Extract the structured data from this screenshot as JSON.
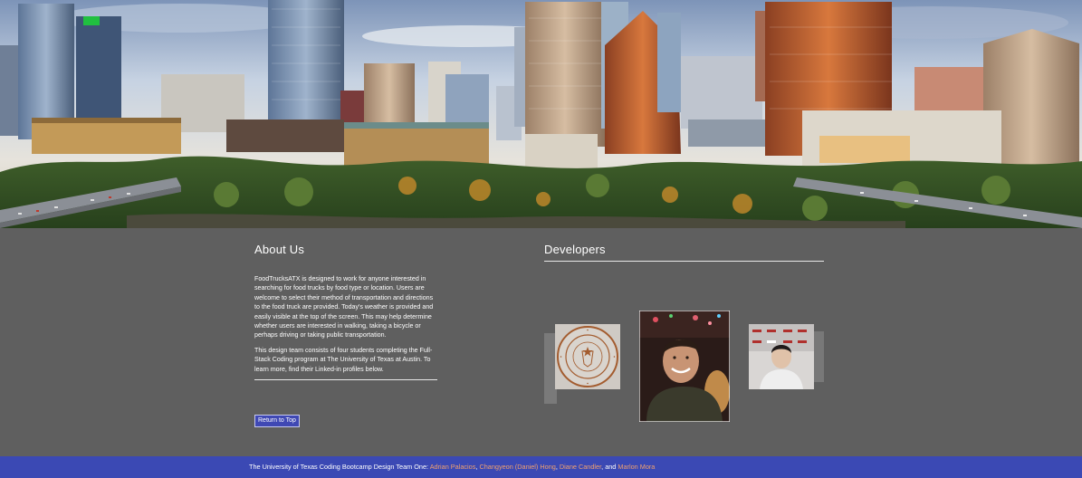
{
  "about": {
    "heading": "About Us",
    "paragraph1": "FoodTrucksATX is designed to work for anyone interested in searching for food trucks by food type or location. Users are welcome to select their method of transportation and directions to the food truck are provided. Today's weather is provided and easily visible at the top of the screen. This may help determine whether users are interested in walking, taking a bicycle or perhaps driving or taking public transportation.",
    "paragraph2": "This design team consists of four students completing the Full-Stack Coding program at The University of Texas at Austin. To learn more, find their Linked-in profiles below.",
    "return_button": "Return to Top"
  },
  "developers": {
    "heading": "Developers",
    "photos": [
      "ut-seal-photo",
      "developer-photo-man-smiling",
      "developer-photo-young-man"
    ]
  },
  "footer": {
    "prefix": "The University of Texas Coding Bootcamp Design Team One: ",
    "names": [
      "Adrian Palacios",
      "Changyeon (Daniel) Hong",
      "Diane Candler",
      "Marlon Mora"
    ],
    "sep1": ", ",
    "sep2": ", ",
    "sep3": ", and ",
    "link_color": "#f0a070"
  },
  "colors": {
    "page_bg": "#5f5f5f",
    "footer_bg": "#3b49b4",
    "button_bg": "#3f48b4"
  }
}
